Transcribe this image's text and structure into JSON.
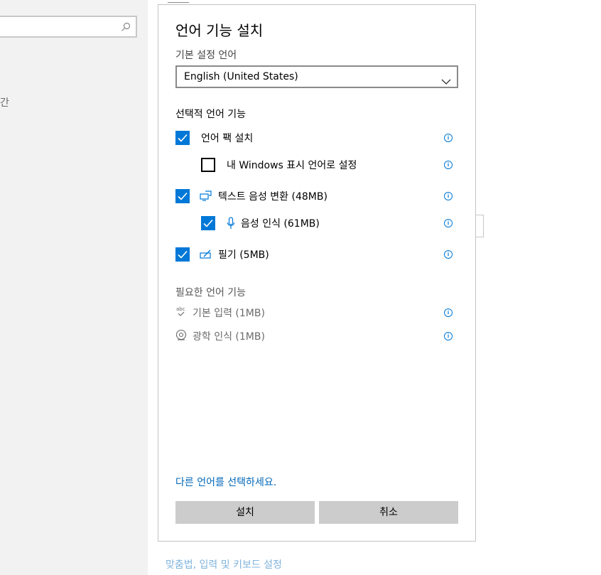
{
  "background": {
    "left_text": "간",
    "bottom_link": "맞춤법, 입력 및 키보드 설정"
  },
  "dialog": {
    "title": "언어 기능 설치",
    "preferred_label": "기본 설정 언어",
    "language_select": "English (United States)",
    "optional_heading": "선택적 언어 기능",
    "options": [
      {
        "label": "언어 팩 설치",
        "checked": true
      },
      {
        "label": "내 Windows 표시 언어로 설정",
        "checked": false
      },
      {
        "label": "텍스트 음성 변환 (48MB)",
        "checked": true,
        "icon": "speech-icon"
      },
      {
        "label": "음성 인식 (61MB)",
        "checked": true,
        "icon": "microphone-icon"
      },
      {
        "label": "필기 (5MB)",
        "checked": true,
        "icon": "handwriting-icon"
      }
    ],
    "required_heading": "필요한 언어 기능",
    "required": [
      {
        "label": "기본 입력 (1MB)",
        "icon": "abc-check-icon"
      },
      {
        "label": "광학 인식 (1MB)",
        "icon": "ocr-icon"
      }
    ],
    "choose_link": "다른 언어를 선택하세요.",
    "install_button": "설치",
    "cancel_button": "취소",
    "info_glyph": "i"
  },
  "colors": {
    "accent": "#0078d7",
    "link": "#0067b8",
    "button_bg": "#cccccc"
  }
}
